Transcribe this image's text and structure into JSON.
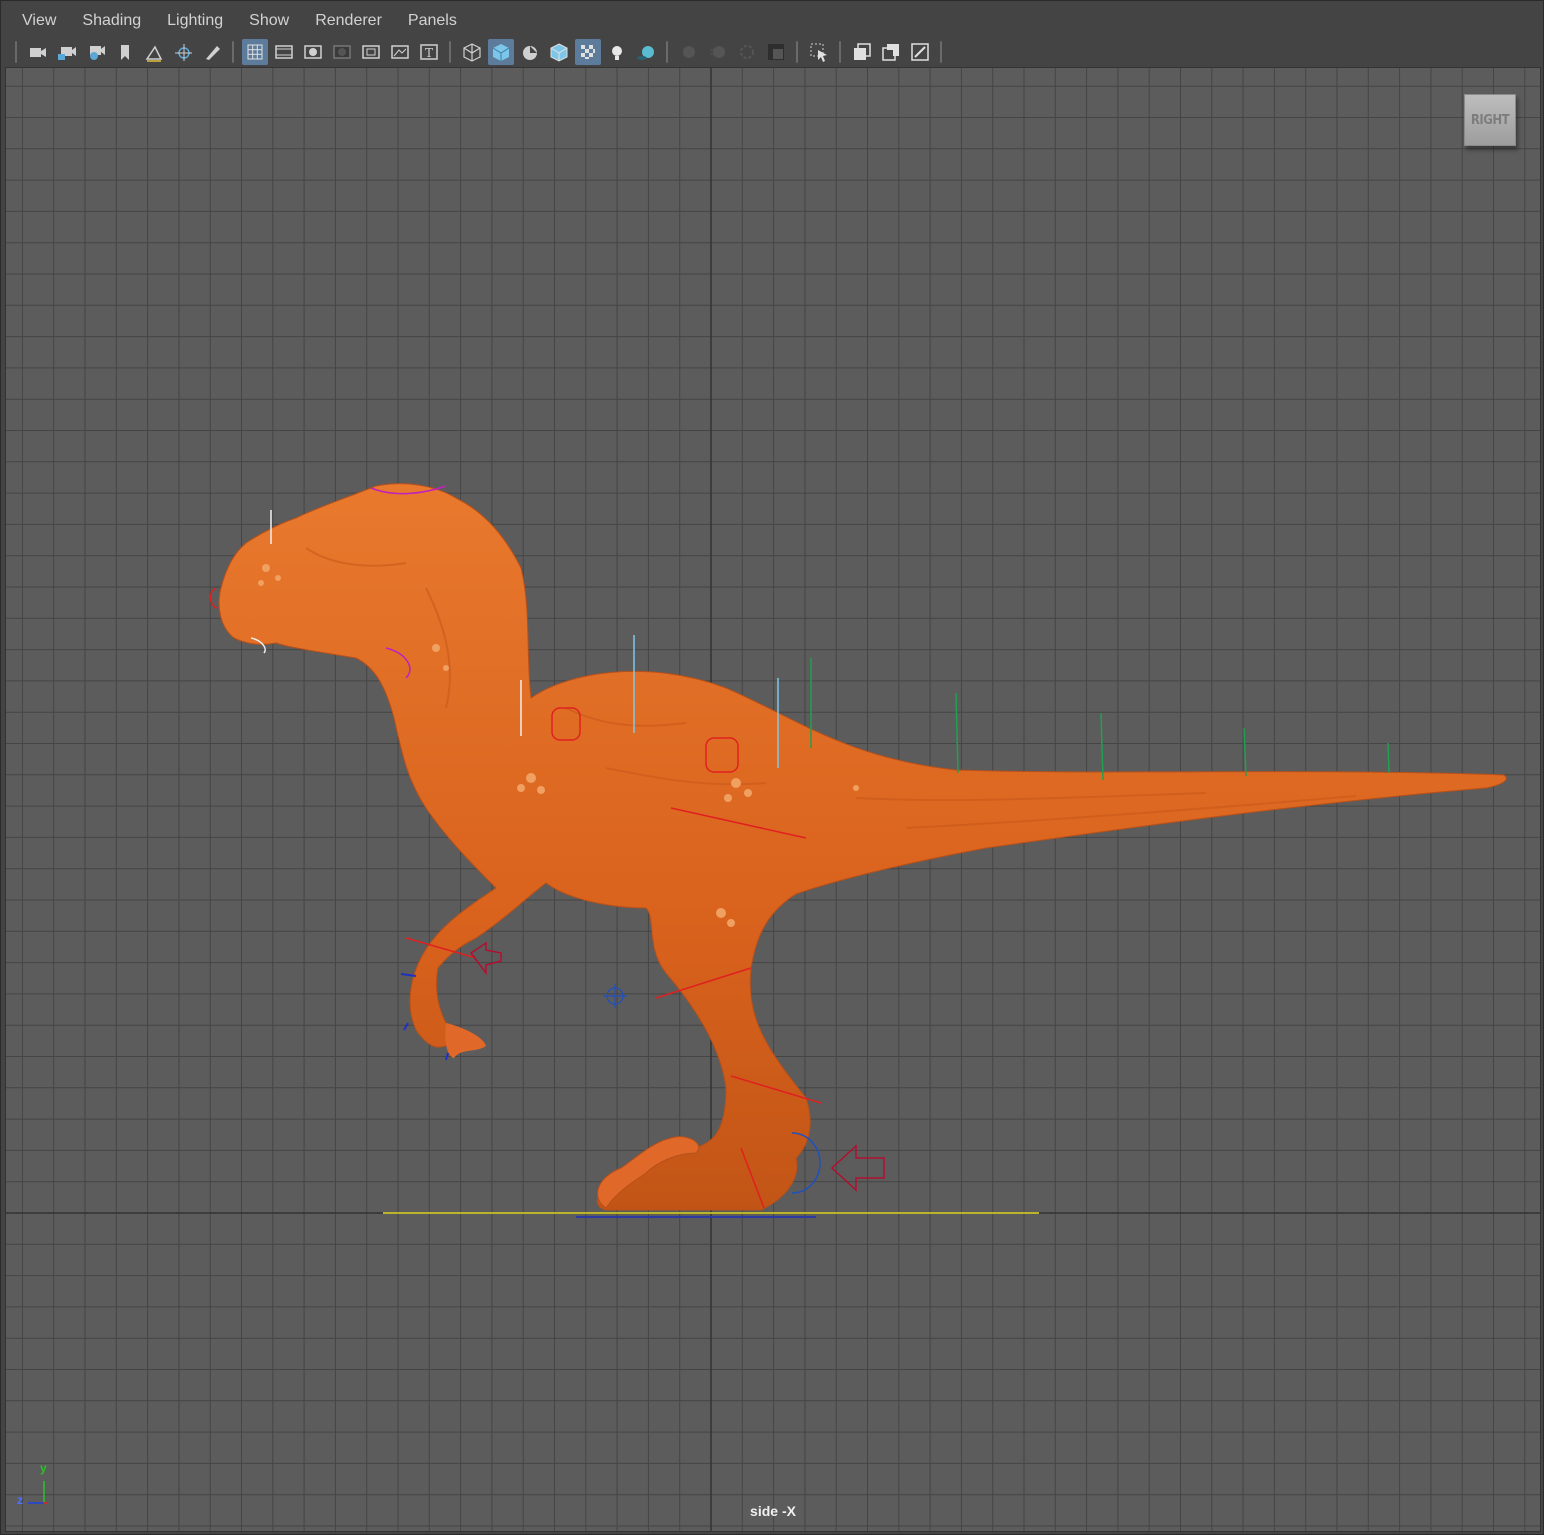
{
  "menubar": {
    "items": [
      "View",
      "Shading",
      "Lighting",
      "Show",
      "Renderer",
      "Panels"
    ]
  },
  "toolbar": {
    "groups": [
      [
        "camera-icon",
        "camera-lock-icon",
        "camera-attributes-icon",
        "bookmark-icon",
        "image-plane-icon",
        "2d-pan-zoom-icon",
        "grease-pencil-icon"
      ],
      [
        "grid-icon",
        "film-gate-icon",
        "resolution-gate-icon",
        "gate-mask-icon",
        "field-chart-icon",
        "safe-action-icon",
        "safe-title-icon"
      ],
      [
        "wireframe-icon",
        "smooth-shade-icon",
        "default-material-icon",
        "wireframe-on-shaded-icon",
        "textured-icon",
        "use-all-lights-icon",
        "shadows-icon"
      ],
      [
        "ambient-occlusion-icon",
        "motion-blur-icon",
        "multisample-aa-icon",
        "depth-of-field-icon"
      ],
      [
        "isolate-select-icon"
      ],
      [
        "xray-icon",
        "xray-active-components-icon",
        "xray-joints-icon"
      ]
    ],
    "active": [
      "grid-icon",
      "smooth-shade-icon",
      "textured-icon"
    ]
  },
  "viewport": {
    "camera_label": "side -X",
    "view_cube_label": "RIGHT",
    "axis": {
      "y": "y",
      "z": "z"
    },
    "background_color": "#5c5c5c",
    "grid_color": "#454545",
    "axis_line_color": "#333333",
    "ground_line_color": "#e8e020",
    "model_color": "#e26a22"
  }
}
